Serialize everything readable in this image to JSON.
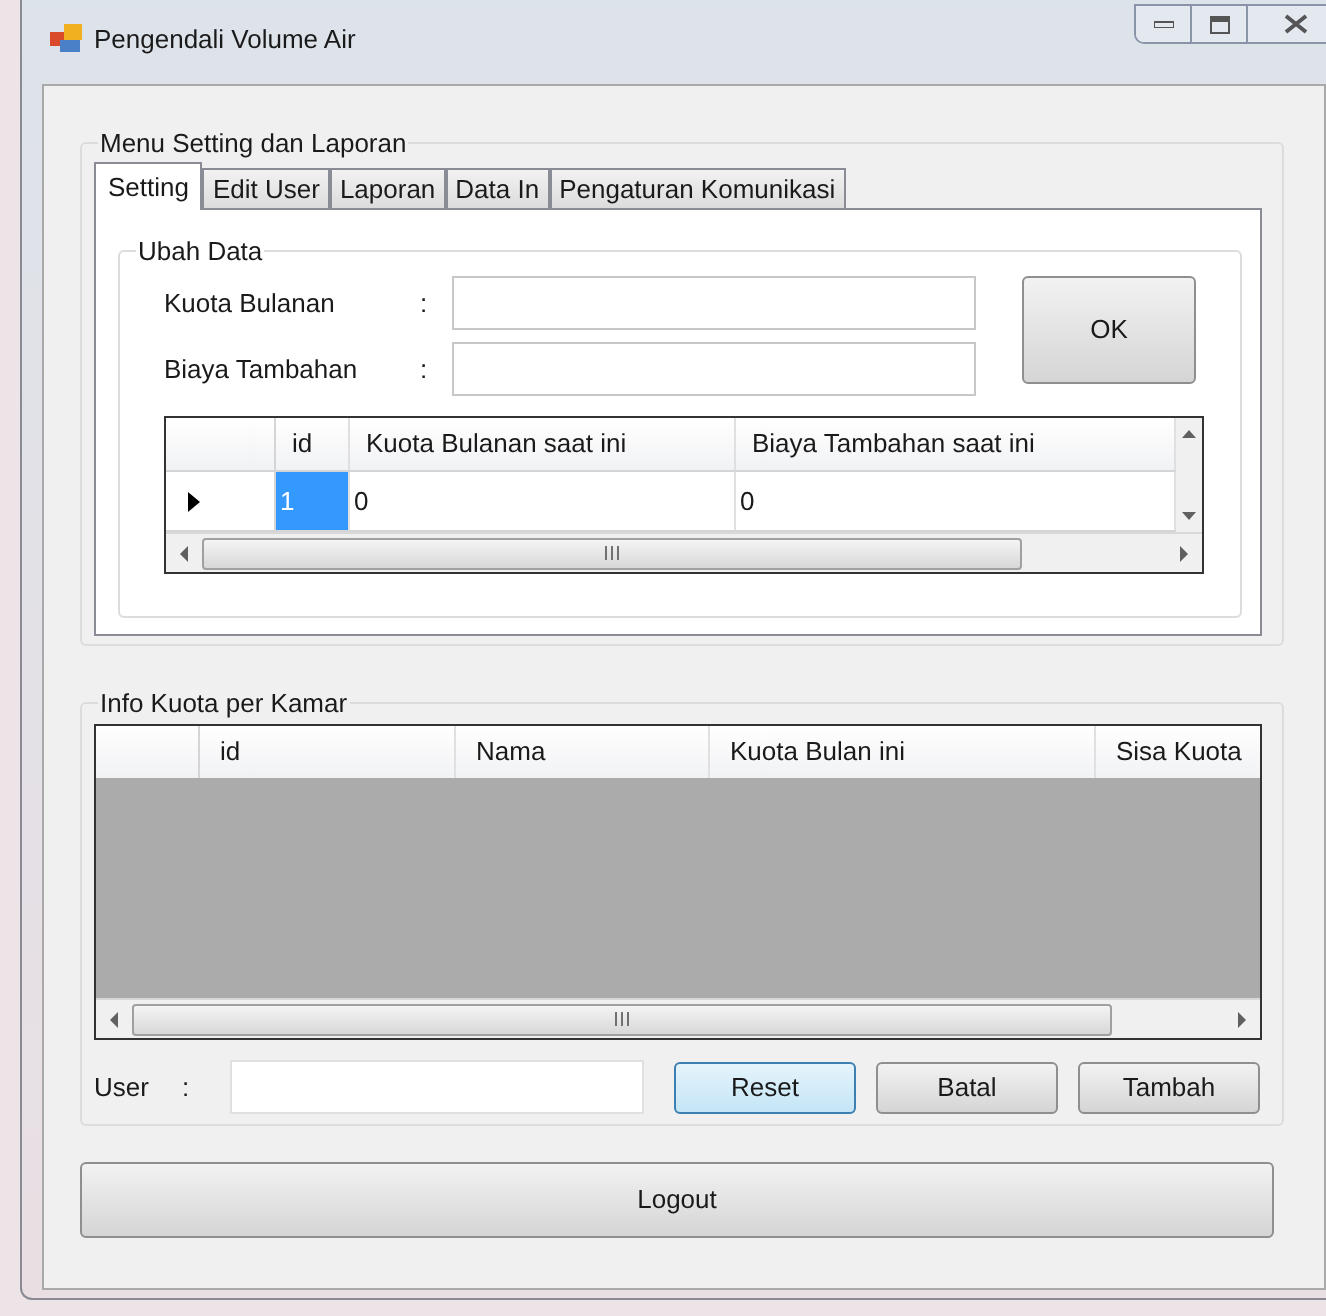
{
  "window": {
    "title": "Pengendali Volume Air"
  },
  "settings_group": {
    "title": "Menu Setting dan Laporan",
    "tabs": [
      {
        "label": "Setting",
        "selected": true
      },
      {
        "label": "Edit User",
        "selected": false
      },
      {
        "label": "Laporan",
        "selected": false
      },
      {
        "label": "Data In",
        "selected": false
      },
      {
        "label": "Pengaturan Komunikasi",
        "selected": false
      }
    ],
    "ubah_data": {
      "title": "Ubah Data",
      "fields": [
        {
          "label": "Kuota Bulanan",
          "separator": ":"
        },
        {
          "label": "Biaya Tambahan",
          "separator": ":"
        }
      ],
      "ok_button": "OK",
      "grid": {
        "columns": [
          "id",
          "Kuota Bulanan saat ini",
          "Biaya Tambahan saat ini"
        ],
        "rows": [
          {
            "selected": true,
            "cells": [
              "1",
              "0",
              "0"
            ]
          }
        ]
      }
    }
  },
  "info_group": {
    "title": "Info Kuota per Kamar",
    "grid": {
      "columns": [
        "id",
        "Nama",
        "Kuota Bulan ini",
        "Sisa Kuota"
      ]
    },
    "user_field": {
      "label": "User",
      "separator": ":"
    },
    "buttons": [
      {
        "label": "Reset",
        "focused": true
      },
      {
        "label": "Batal",
        "focused": false
      },
      {
        "label": "Tambah",
        "focused": false
      }
    ]
  },
  "logout_button": "Logout"
}
